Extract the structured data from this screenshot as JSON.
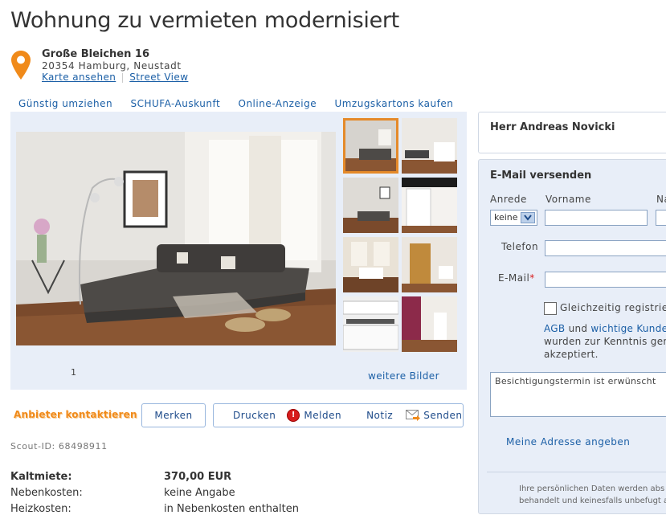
{
  "title": "Wohnung zu vermieten modernisiert",
  "address": {
    "street": "Große Bleichen 16",
    "city": "20354 Hamburg, Neustadt",
    "map_link": "Karte ansehen",
    "streetview_link": "Street View"
  },
  "quick_links": [
    "Günstig umziehen",
    "SCHUFA-Auskunft",
    "Online-Anzeige",
    "Umzugskartons kaufen"
  ],
  "gallery": {
    "counter": "1",
    "more_pictures": "weitere Bilder"
  },
  "actions": {
    "contact": "Anbieter kontaktieren",
    "merken": "Merken",
    "drucken": "Drucken",
    "melden": "Melden",
    "notiz": "Notiz",
    "senden": "Senden"
  },
  "scout_id": "Scout-ID: 68498911",
  "costs": [
    {
      "label": "Kaltmiete:",
      "value": "370,00 EUR"
    },
    {
      "label": "Nebenkosten:",
      "value": "keine Angabe"
    },
    {
      "label": "Heizkosten:",
      "value": "in Nebenkosten enthalten"
    }
  ],
  "agent": {
    "name": "Herr Andreas Novicki"
  },
  "form": {
    "title": "E-Mail versenden",
    "anrede_label": "Anrede",
    "anrede_value": "keine",
    "vorname_label": "Vorname",
    "nachname_label": "Na",
    "telefon_label": "Telefon",
    "email_label": "E-Mail",
    "required_mark": "*",
    "checkbox_label": "Gleichzeitig registrieren",
    "agb_link": "AGB",
    "agb_und": "und",
    "kunden_link": "wichtige Kunde",
    "agb_rest1": "wurden zur Kenntnis gen",
    "agb_rest2": "akzeptiert.",
    "message": "Besichtigungstermin ist erwünscht",
    "address_link": "Meine Adresse angeben",
    "privacy1": "Ihre persönlichen Daten werden abs",
    "privacy2": "behandelt und keinesfalls unbefugt a"
  },
  "colors": {
    "accent_blue": "#1b5fa6",
    "panel_bg": "#e8eef8",
    "highlight_orange": "#e58a2a"
  }
}
